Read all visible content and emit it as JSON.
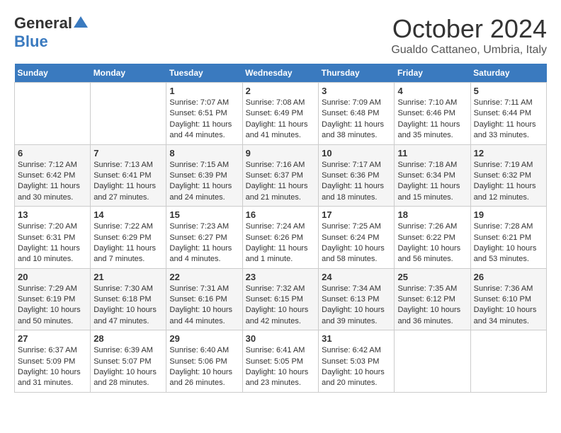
{
  "logo": {
    "general": "General",
    "blue": "Blue"
  },
  "title": "October 2024",
  "location": "Gualdo Cattaneo, Umbria, Italy",
  "days_header": [
    "Sunday",
    "Monday",
    "Tuesday",
    "Wednesday",
    "Thursday",
    "Friday",
    "Saturday"
  ],
  "weeks": [
    [
      {
        "day": "",
        "data": ""
      },
      {
        "day": "",
        "data": ""
      },
      {
        "day": "1",
        "data": "Sunrise: 7:07 AM\nSunset: 6:51 PM\nDaylight: 11 hours and 44 minutes."
      },
      {
        "day": "2",
        "data": "Sunrise: 7:08 AM\nSunset: 6:49 PM\nDaylight: 11 hours and 41 minutes."
      },
      {
        "day": "3",
        "data": "Sunrise: 7:09 AM\nSunset: 6:48 PM\nDaylight: 11 hours and 38 minutes."
      },
      {
        "day": "4",
        "data": "Sunrise: 7:10 AM\nSunset: 6:46 PM\nDaylight: 11 hours and 35 minutes."
      },
      {
        "day": "5",
        "data": "Sunrise: 7:11 AM\nSunset: 6:44 PM\nDaylight: 11 hours and 33 minutes."
      }
    ],
    [
      {
        "day": "6",
        "data": "Sunrise: 7:12 AM\nSunset: 6:42 PM\nDaylight: 11 hours and 30 minutes."
      },
      {
        "day": "7",
        "data": "Sunrise: 7:13 AM\nSunset: 6:41 PM\nDaylight: 11 hours and 27 minutes."
      },
      {
        "day": "8",
        "data": "Sunrise: 7:15 AM\nSunset: 6:39 PM\nDaylight: 11 hours and 24 minutes."
      },
      {
        "day": "9",
        "data": "Sunrise: 7:16 AM\nSunset: 6:37 PM\nDaylight: 11 hours and 21 minutes."
      },
      {
        "day": "10",
        "data": "Sunrise: 7:17 AM\nSunset: 6:36 PM\nDaylight: 11 hours and 18 minutes."
      },
      {
        "day": "11",
        "data": "Sunrise: 7:18 AM\nSunset: 6:34 PM\nDaylight: 11 hours and 15 minutes."
      },
      {
        "day": "12",
        "data": "Sunrise: 7:19 AM\nSunset: 6:32 PM\nDaylight: 11 hours and 12 minutes."
      }
    ],
    [
      {
        "day": "13",
        "data": "Sunrise: 7:20 AM\nSunset: 6:31 PM\nDaylight: 11 hours and 10 minutes."
      },
      {
        "day": "14",
        "data": "Sunrise: 7:22 AM\nSunset: 6:29 PM\nDaylight: 11 hours and 7 minutes."
      },
      {
        "day": "15",
        "data": "Sunrise: 7:23 AM\nSunset: 6:27 PM\nDaylight: 11 hours and 4 minutes."
      },
      {
        "day": "16",
        "data": "Sunrise: 7:24 AM\nSunset: 6:26 PM\nDaylight: 11 hours and 1 minute."
      },
      {
        "day": "17",
        "data": "Sunrise: 7:25 AM\nSunset: 6:24 PM\nDaylight: 10 hours and 58 minutes."
      },
      {
        "day": "18",
        "data": "Sunrise: 7:26 AM\nSunset: 6:22 PM\nDaylight: 10 hours and 56 minutes."
      },
      {
        "day": "19",
        "data": "Sunrise: 7:28 AM\nSunset: 6:21 PM\nDaylight: 10 hours and 53 minutes."
      }
    ],
    [
      {
        "day": "20",
        "data": "Sunrise: 7:29 AM\nSunset: 6:19 PM\nDaylight: 10 hours and 50 minutes."
      },
      {
        "day": "21",
        "data": "Sunrise: 7:30 AM\nSunset: 6:18 PM\nDaylight: 10 hours and 47 minutes."
      },
      {
        "day": "22",
        "data": "Sunrise: 7:31 AM\nSunset: 6:16 PM\nDaylight: 10 hours and 44 minutes."
      },
      {
        "day": "23",
        "data": "Sunrise: 7:32 AM\nSunset: 6:15 PM\nDaylight: 10 hours and 42 minutes."
      },
      {
        "day": "24",
        "data": "Sunrise: 7:34 AM\nSunset: 6:13 PM\nDaylight: 10 hours and 39 minutes."
      },
      {
        "day": "25",
        "data": "Sunrise: 7:35 AM\nSunset: 6:12 PM\nDaylight: 10 hours and 36 minutes."
      },
      {
        "day": "26",
        "data": "Sunrise: 7:36 AM\nSunset: 6:10 PM\nDaylight: 10 hours and 34 minutes."
      }
    ],
    [
      {
        "day": "27",
        "data": "Sunrise: 6:37 AM\nSunset: 5:09 PM\nDaylight: 10 hours and 31 minutes."
      },
      {
        "day": "28",
        "data": "Sunrise: 6:39 AM\nSunset: 5:07 PM\nDaylight: 10 hours and 28 minutes."
      },
      {
        "day": "29",
        "data": "Sunrise: 6:40 AM\nSunset: 5:06 PM\nDaylight: 10 hours and 26 minutes."
      },
      {
        "day": "30",
        "data": "Sunrise: 6:41 AM\nSunset: 5:05 PM\nDaylight: 10 hours and 23 minutes."
      },
      {
        "day": "31",
        "data": "Sunrise: 6:42 AM\nSunset: 5:03 PM\nDaylight: 10 hours and 20 minutes."
      },
      {
        "day": "",
        "data": ""
      },
      {
        "day": "",
        "data": ""
      }
    ]
  ]
}
